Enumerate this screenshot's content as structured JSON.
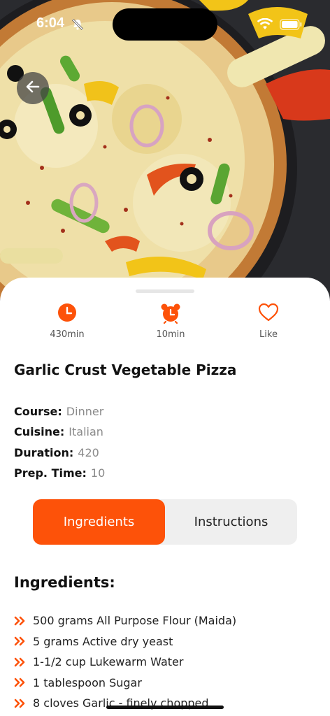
{
  "status_bar": {
    "time": "6:04"
  },
  "recipe": {
    "title": "Garlic Crust Vegetable Pizza",
    "stats": [
      {
        "icon": "clock-icon",
        "label": "430min"
      },
      {
        "icon": "alarm-clock-icon",
        "label": "10min"
      },
      {
        "icon": "heart-icon",
        "label": "Like"
      }
    ],
    "meta": [
      {
        "key": "Course:",
        "value": "Dinner"
      },
      {
        "key": "Cuisine:",
        "value": "Italian"
      },
      {
        "key": "Duration:",
        "value": "420"
      },
      {
        "key": "Prep. Time:",
        "value": "10"
      }
    ]
  },
  "tabs": {
    "ingredients": "Ingredients",
    "instructions": "Instructions",
    "active": "ingredients"
  },
  "ingredients": {
    "heading": "Ingredients:",
    "items": [
      "500 grams All Purpose Flour (Maida)",
      "5 grams Active dry yeast",
      "1-1/2 cup Lukewarm Water",
      "1 tablespoon Sugar",
      "8 cloves Garlic - finely chopped"
    ]
  },
  "colors": {
    "accent": "#fd5209",
    "tab_bg": "#efefef",
    "muted_text": "#8a8a8a"
  }
}
